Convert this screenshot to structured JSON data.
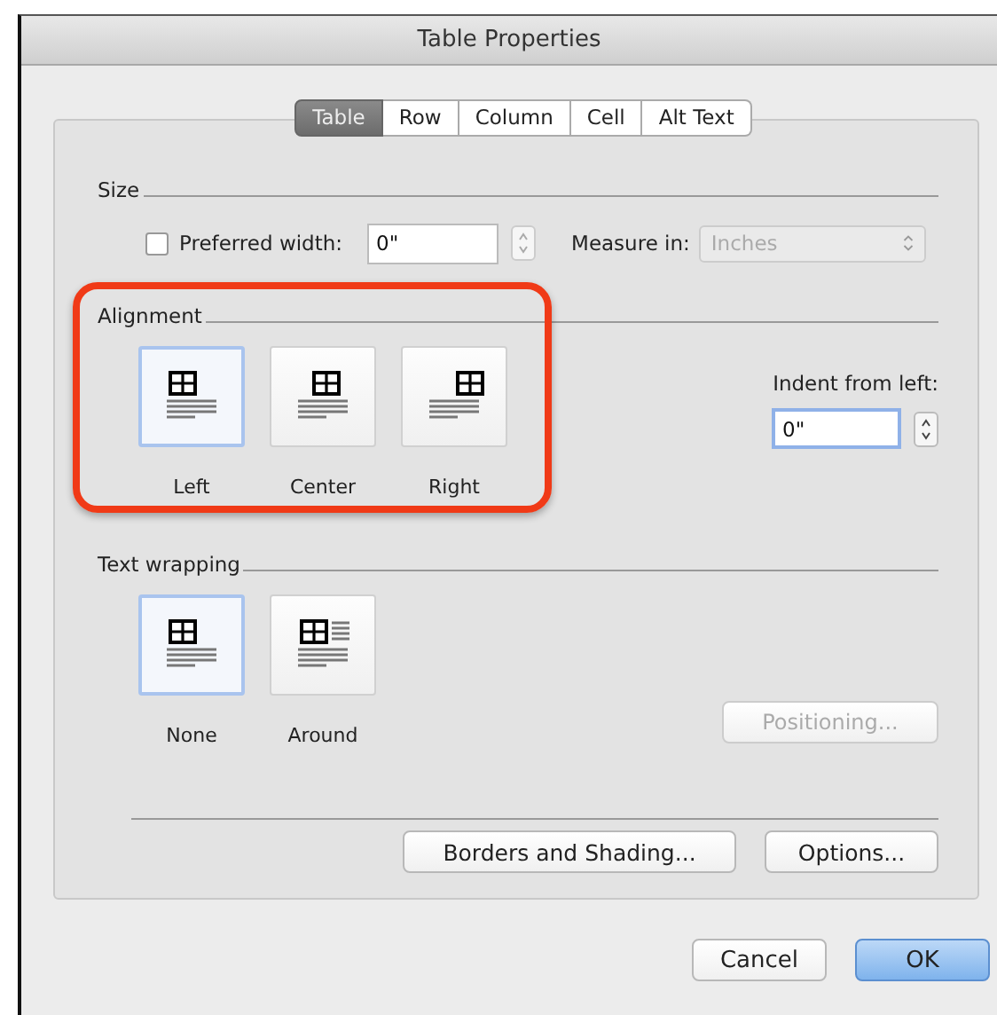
{
  "window": {
    "title": "Table Properties"
  },
  "tabs": [
    {
      "label": "Table",
      "selected": true
    },
    {
      "label": "Row",
      "selected": false
    },
    {
      "label": "Column",
      "selected": false
    },
    {
      "label": "Cell",
      "selected": false
    },
    {
      "label": "Alt Text",
      "selected": false
    }
  ],
  "size": {
    "label": "Size",
    "preferred_width": {
      "label": "Preferred width:",
      "checked": false,
      "value": "0\""
    },
    "measure_in": {
      "label": "Measure in:",
      "value": "Inches",
      "disabled": true
    }
  },
  "alignment": {
    "label": "Alignment",
    "highlighted": true,
    "options": [
      {
        "label": "Left",
        "kind": "left",
        "selected": true
      },
      {
        "label": "Center",
        "kind": "center",
        "selected": false
      },
      {
        "label": "Right",
        "kind": "right",
        "selected": false
      }
    ],
    "indent": {
      "label": "Indent from left:",
      "value": "0\""
    }
  },
  "text_wrapping": {
    "label": "Text wrapping",
    "options": [
      {
        "label": "None",
        "kind": "none",
        "selected": true
      },
      {
        "label": "Around",
        "kind": "around",
        "selected": false
      }
    ],
    "positioning_button": {
      "label": "Positioning...",
      "disabled": true
    }
  },
  "panel_buttons": [
    "Borders and Shading...",
    "Options..."
  ],
  "buttons": [
    {
      "label": "Cancel",
      "default": false
    },
    {
      "label": "OK",
      "default": true
    }
  ]
}
